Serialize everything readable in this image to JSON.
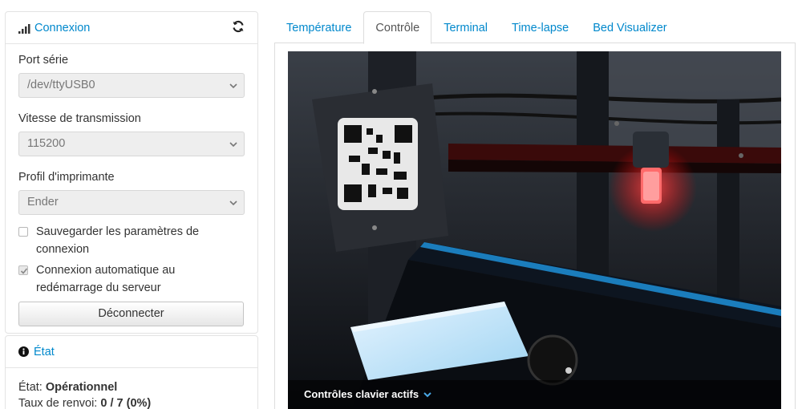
{
  "connection": {
    "title": "Connexion",
    "port_label": "Port série",
    "port_value": "/dev/ttyUSB0",
    "baud_label": "Vitesse de transmission",
    "baud_value": "115200",
    "profile_label": "Profil d'imprimante",
    "profile_value": "Ender",
    "save_settings_label": "Sauvegarder les paramètres de connexion",
    "autoconnect_label": "Connexion automatique au redémarrage du serveur",
    "disconnect_label": "Déconnecter"
  },
  "state": {
    "title": "État",
    "state_label": "État:",
    "state_value": "Opérationnel",
    "resend_label": "Taux de renvoi:",
    "resend_value": "0 / 7 (0%)"
  },
  "tabs": [
    {
      "label": "Température"
    },
    {
      "label": "Contrôle"
    },
    {
      "label": "Terminal"
    },
    {
      "label": "Time-lapse"
    },
    {
      "label": "Bed Visualizer"
    }
  ],
  "webcam": {
    "keyboard_controls_label": "Contrôles clavier actifs"
  },
  "colors": {
    "link": "#0088cc",
    "panel_border": "#e3e3e3"
  }
}
